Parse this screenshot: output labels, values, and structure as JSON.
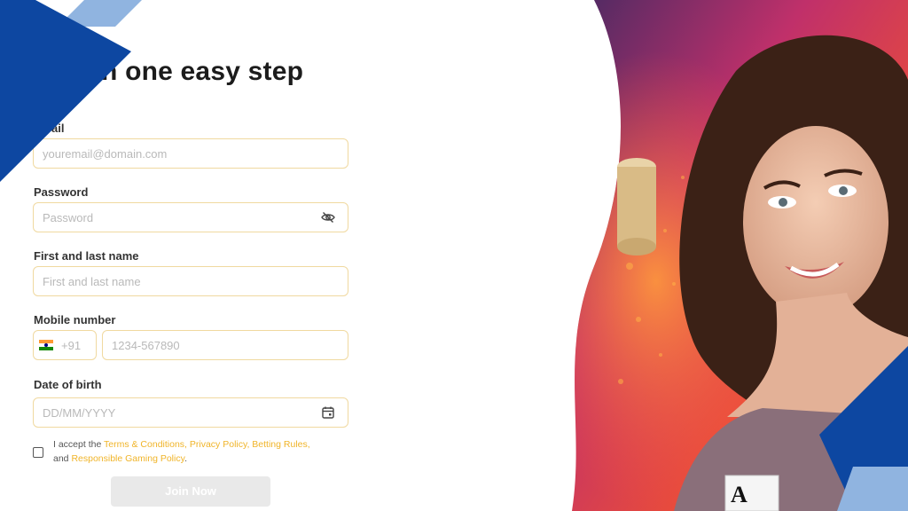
{
  "form": {
    "title": "ter in one easy step",
    "email": {
      "label": "ail",
      "placeholder": "youremail@domain.com"
    },
    "password": {
      "label": "Password",
      "placeholder": "Password",
      "icon": "eye-off-icon"
    },
    "name": {
      "label": "First and last name",
      "placeholder": "First and last name"
    },
    "mobile": {
      "label": "Mobile number",
      "country_code": "+91",
      "placeholder": "1234-567890",
      "flag": "india-flag-icon"
    },
    "dob": {
      "label": "Date of birth",
      "placeholder": "DD/MM/YYYY",
      "icon": "calendar-icon"
    },
    "terms": {
      "prefix": "I accept the ",
      "link1": "Terms & Conditions, Privacy Policy, Betting Rules,",
      "middle": "and ",
      "link2": "Responsible Gaming Policy",
      "suffix": "."
    },
    "join_label": "Join Now"
  },
  "colors": {
    "accent": "#f0b429",
    "input_border": "#f0d9a0",
    "deco_blue": "#0d47a1",
    "deco_light_blue": "#90b4e0",
    "button_disabled": "#e9e9e9"
  },
  "hero": {
    "description_icon": "promo-image",
    "card_rank": "A"
  }
}
